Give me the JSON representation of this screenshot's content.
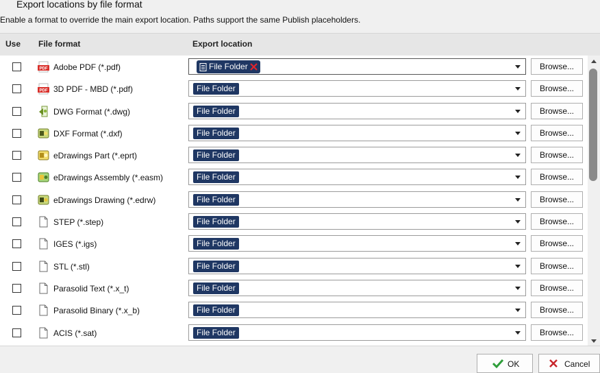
{
  "dialog": {
    "title": "Export locations by file format",
    "subtitle": "Enable a format to override the main export location. Paths support the same Publish placeholders."
  },
  "grid": {
    "headers": {
      "use": "Use",
      "format": "File format",
      "location": "Export location"
    },
    "rows": [
      {
        "label": "Adobe PDF (*.pdf)",
        "icon": "pdf-icon",
        "location": "File Folder",
        "checked": false,
        "chip_style": "removable"
      },
      {
        "label": "3D PDF - MBD (*.pdf)",
        "icon": "pdf-icon",
        "location": "File Folder",
        "checked": false
      },
      {
        "label": "DWG Format (*.dwg)",
        "icon": "dwg-icon",
        "location": "File Folder",
        "checked": false
      },
      {
        "label": "DXF Format (*.dxf)",
        "icon": "dxf-icon",
        "location": "File Folder",
        "checked": false
      },
      {
        "label": "eDrawings Part (*.eprt)",
        "icon": "edrawings-part-icon",
        "location": "File Folder",
        "checked": false
      },
      {
        "label": "eDrawings Assembly (*.easm)",
        "icon": "edrawings-assembly-icon",
        "location": "File Folder",
        "checked": false
      },
      {
        "label": "eDrawings Drawing (*.edrw)",
        "icon": "edrawings-drawing-icon",
        "location": "File Folder",
        "checked": false
      },
      {
        "label": "STEP (*.step)",
        "icon": "generic-file-icon",
        "location": "File Folder",
        "checked": false
      },
      {
        "label": "IGES (*.igs)",
        "icon": "generic-file-icon",
        "location": "File Folder",
        "checked": false
      },
      {
        "label": "STL (*.stl)",
        "icon": "generic-file-icon",
        "location": "File Folder",
        "checked": false
      },
      {
        "label": "Parasolid Text (*.x_t)",
        "icon": "generic-file-icon",
        "location": "File Folder",
        "checked": false
      },
      {
        "label": "Parasolid Binary (*.x_b)",
        "icon": "generic-file-icon",
        "location": "File Folder",
        "checked": false
      },
      {
        "label": "ACIS (*.sat)",
        "icon": "generic-file-icon",
        "location": "File Folder",
        "checked": false
      }
    ],
    "browse_label": "Browse..."
  },
  "buttons": {
    "ok": "OK",
    "cancel": "Cancel"
  },
  "colors": {
    "chip_bg": "#1f3763",
    "remove_x": "#e0242b",
    "ok_check": "#2e9e3a",
    "cancel_x": "#c8262b"
  }
}
